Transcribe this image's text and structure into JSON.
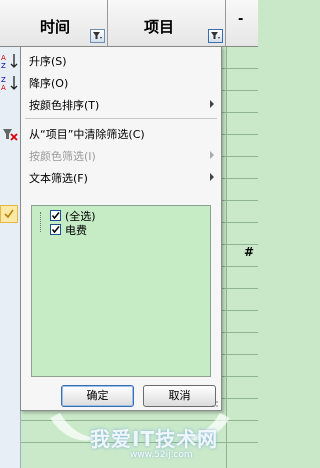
{
  "header": {
    "col1_label": "时间",
    "col2_label": "项目",
    "col3_fragment": "-"
  },
  "menu": {
    "items": [
      {
        "label": "升序(S)",
        "enabled": true
      },
      {
        "label": "降序(O)",
        "enabled": true
      },
      {
        "label": "按颜色排序(T)",
        "enabled": true,
        "submenu": true
      },
      {
        "label": "从“项目”中清除筛选(C)",
        "enabled": true
      },
      {
        "label": "按颜色筛选(I)",
        "enabled": false,
        "submenu": true
      },
      {
        "label": "文本筛选(F)",
        "enabled": true,
        "submenu": true
      }
    ]
  },
  "filter_list": {
    "items": [
      {
        "label": "(全选)",
        "checked": true
      },
      {
        "label": "电费",
        "checked": true
      }
    ]
  },
  "buttons": {
    "ok": "确定",
    "cancel": "取消"
  },
  "cell_fragment": "#",
  "watermark": {
    "text": "我爱IT技术网",
    "url": "www.52ij.com"
  },
  "colors": {
    "sheet_bg": "#c9e9c9",
    "menu_bg": "#f6f6f6",
    "listbox_bg": "#c5ecc5",
    "accent_border": "#3b6db0"
  }
}
